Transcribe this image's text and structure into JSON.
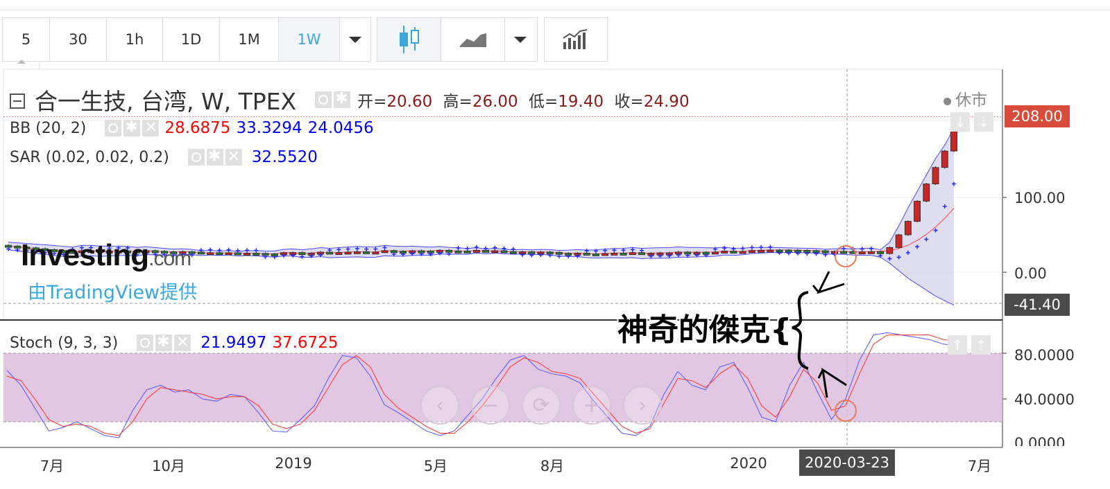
{
  "toolbar": {
    "intervals": [
      "5",
      "30",
      "1h",
      "1D",
      "1M",
      "1W"
    ],
    "active_interval": "1W",
    "icons": [
      "interval-dropdown-icon",
      "candlestick-icon",
      "line-chart-icon",
      "chart-type-dropdown-icon",
      "indicators-icon"
    ]
  },
  "legend": {
    "title": "合一生技, 台湾, W, TPEX",
    "ohlc": {
      "open_label": "开=",
      "open": "20.60",
      "high_label": "高=",
      "high": "26.00",
      "low_label": "低=",
      "low": "19.40",
      "close_label": "收=",
      "close": "24.90"
    },
    "bb": {
      "label": "BB (20, 2)",
      "v1": "28.6875",
      "v2": "33.3294",
      "v3": "24.0456"
    },
    "sar": {
      "label": "SAR (0.02, 0.02, 0.2)",
      "v1": "32.5520"
    },
    "stoch": {
      "label": "Stoch (9, 3, 3)",
      "v1": "21.9497",
      "v2": "37.6725"
    }
  },
  "market_status": "休市",
  "watermark": {
    "brand": "Investing",
    "suffix": ".com",
    "provider": "由TradingView提供"
  },
  "annotation": "神奇的傑克{",
  "colors": {
    "up": "#2e7d32",
    "down": "#c62828",
    "bb_fill": "#d6d6ec",
    "stoch_band": "#dcbddc",
    "tag_red": "#d94c3b",
    "tag_dark": "#4a4a4a"
  },
  "chart_data": [
    {
      "type": "candlestick",
      "title": "合一生技, 台湾, W, TPEX",
      "price_axis": {
        "ticks": [
          "100.00",
          "0.00"
        ],
        "current_price_tag": "208.00",
        "crosshair_price_tag": "-41.40"
      },
      "x_ticks": [
        "7月",
        "10月",
        "2019",
        "5月",
        "8月",
        "2020",
        "2020-03-23",
        "7月"
      ],
      "highlighted_x": "2020-03-23",
      "approx_price_levels": [
        {
          "period": "2018-06",
          "close": 28
        },
        {
          "period": "2018-10",
          "close": 26
        },
        {
          "period": "2019-01",
          "close": 27
        },
        {
          "period": "2019-05",
          "close": 27
        },
        {
          "period": "2019-08",
          "close": 28
        },
        {
          "period": "2020-01",
          "close": 27
        },
        {
          "period": "2020-03-23",
          "close": 24.9
        },
        {
          "period": "2020-04",
          "close": 33
        },
        {
          "period": "2020-04b",
          "close": 50
        },
        {
          "period": "2020-05",
          "close": 68
        },
        {
          "period": "2020-05b",
          "close": 118
        },
        {
          "period": "2020-06",
          "close": 140
        },
        {
          "period": "2020-06b",
          "close": 162
        },
        {
          "period": "2020-06c",
          "close": 208
        }
      ]
    },
    {
      "type": "line",
      "title": "Stoch (9, 3, 3)",
      "y_ticks": [
        "80.0000",
        "40.0000",
        "0.0000"
      ],
      "band": [
        20,
        80
      ],
      "series": [
        {
          "name": "%K",
          "color": "#5555ff",
          "values": [
            65,
            52,
            32,
            12,
            15,
            20,
            14,
            8,
            6,
            30,
            48,
            52,
            46,
            48,
            40,
            38,
            44,
            42,
            28,
            12,
            11,
            22,
            34,
            58,
            78,
            76,
            60,
            35,
            28,
            20,
            12,
            8,
            12,
            26,
            40,
            58,
            74,
            78,
            66,
            62,
            60,
            54,
            38,
            24,
            10,
            8,
            16,
            44,
            64,
            52,
            48,
            68,
            72,
            50,
            24,
            20,
            52,
            72,
            46,
            22,
            40,
            74,
            96,
            98,
            96,
            94,
            92,
            88,
            86
          ]
        },
        {
          "name": "%D",
          "color": "#ff3333",
          "values": [
            60,
            56,
            40,
            22,
            16,
            18,
            16,
            10,
            8,
            20,
            40,
            50,
            48,
            46,
            44,
            40,
            42,
            42,
            34,
            18,
            14,
            18,
            30,
            50,
            70,
            78,
            68,
            44,
            32,
            24,
            16,
            10,
            10,
            20,
            34,
            50,
            68,
            76,
            72,
            64,
            62,
            58,
            44,
            30,
            16,
            10,
            14,
            36,
            58,
            56,
            50,
            62,
            70,
            58,
            34,
            24,
            42,
            66,
            54,
            30,
            34,
            62,
            88,
            96,
            96,
            96,
            96,
            92,
            90
          ]
        }
      ]
    }
  ],
  "nav_icons": [
    "nav-left-icon",
    "zoom-out-icon",
    "reset-icon",
    "zoom-in-icon",
    "nav-right-icon"
  ]
}
